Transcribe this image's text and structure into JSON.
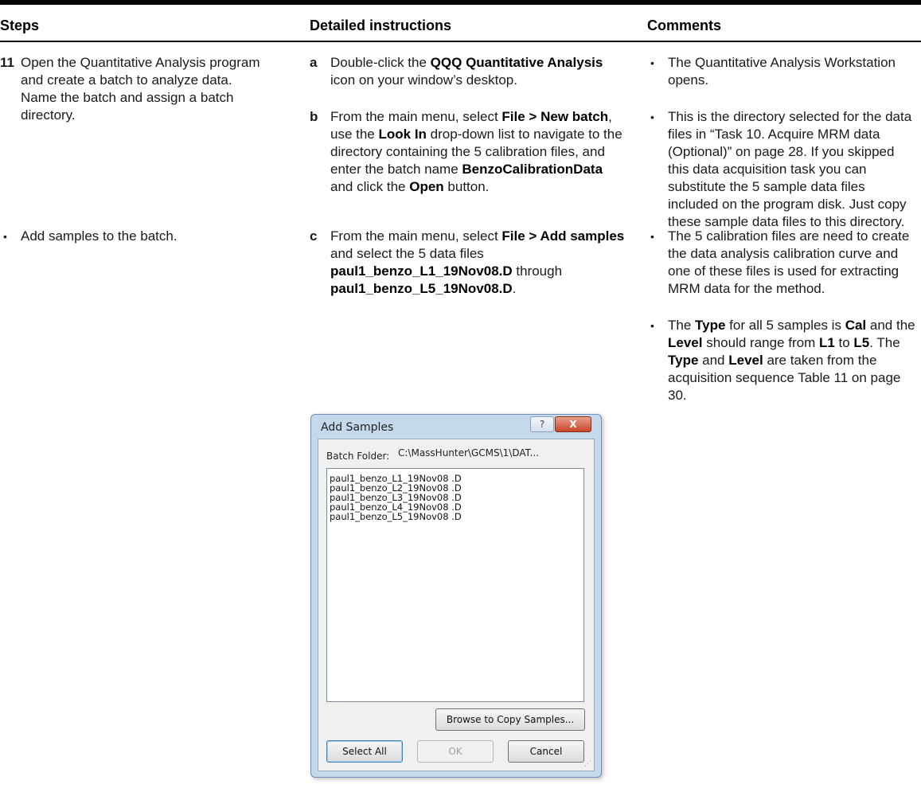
{
  "headers": {
    "steps": "Steps",
    "instructions": "Detailed instructions",
    "comments": "Comments"
  },
  "step11": {
    "number": "11",
    "text1": "Open the Quantitative Analysis program and create a batch to analyze data.",
    "text2": "Name the batch and assign a batch directory."
  },
  "step_bullet": {
    "symbol": "•",
    "text": "Add samples to the batch."
  },
  "instr_a": {
    "letter": "a",
    "pre": "Double-click the ",
    "bold1": "QQQ Quantitative Analysis",
    "post": " icon on your window’s desktop."
  },
  "instr_b": {
    "letter": "b",
    "pre": "From the main menu, select ",
    "bold1": "File > New batch",
    "mid1": ", use the ",
    "bold2": "Look In",
    "mid2": " drop-down list to navigate to the directory containing the 5 calibration files, and enter the batch name ",
    "bold3": "BenzoCalibrationData",
    "mid3": " and click the ",
    "bold4": "Open",
    "post": " button."
  },
  "instr_c": {
    "letter": "c",
    "pre": "From the main menu, select ",
    "bold1": "File > Add samples",
    "mid1": " and select the 5 data files ",
    "bold2": "paul1_benzo_L1_19Nov08.D",
    "mid2": " through ",
    "bold3": "paul1_benzo_L5_19Nov08.D",
    "post": "."
  },
  "comments": {
    "bullet": "•",
    "c1": "The Quantitative Analysis Workstation opens.",
    "c2": "This is the directory selected for the data files in “Task 10. Acquire MRM data (Optional)” on page 28. If you skipped this data acquisition task you can substitute the 5 sample data files included on the program disk. Just copy these sample data files to this directory.",
    "c3": "The 5 calibration files are need to create the data analysis calibration curve and one of these files is used for extracting MRM data for the method.",
    "c4": {
      "t1": "The ",
      "b1": "Type",
      "t2": " for all 5 samples is ",
      "b2": "Cal",
      "t3": " and the ",
      "b3": "Level",
      "t4": " should range from ",
      "b4": "L1",
      "t5": " to ",
      "b5": "L5",
      "t6": ". The ",
      "b6": "Type",
      "t7": " and ",
      "b7": "Level",
      "t8": " are taken from the acquisition sequence Table 11 on page 30."
    }
  },
  "dialog": {
    "title": "Add Samples",
    "help": "?",
    "close": "X",
    "batch_folder_label": "Batch Folder:",
    "batch_folder_value": "C:\\MassHunter\\GCMS\\1\\DAT...",
    "files": [
      "paul1_benzo_L1_19Nov08 .D",
      "paul1_benzo_L2_19Nov08 .D",
      "paul1_benzo_L3_19Nov08 .D",
      "paul1_benzo_L4_19Nov08 .D",
      "paul1_benzo_L5_19Nov08 .D"
    ],
    "browse_button": "Browse to Copy Samples...",
    "select_all_button": "Select All",
    "ok_button": "OK",
    "cancel_button": "Cancel"
  }
}
